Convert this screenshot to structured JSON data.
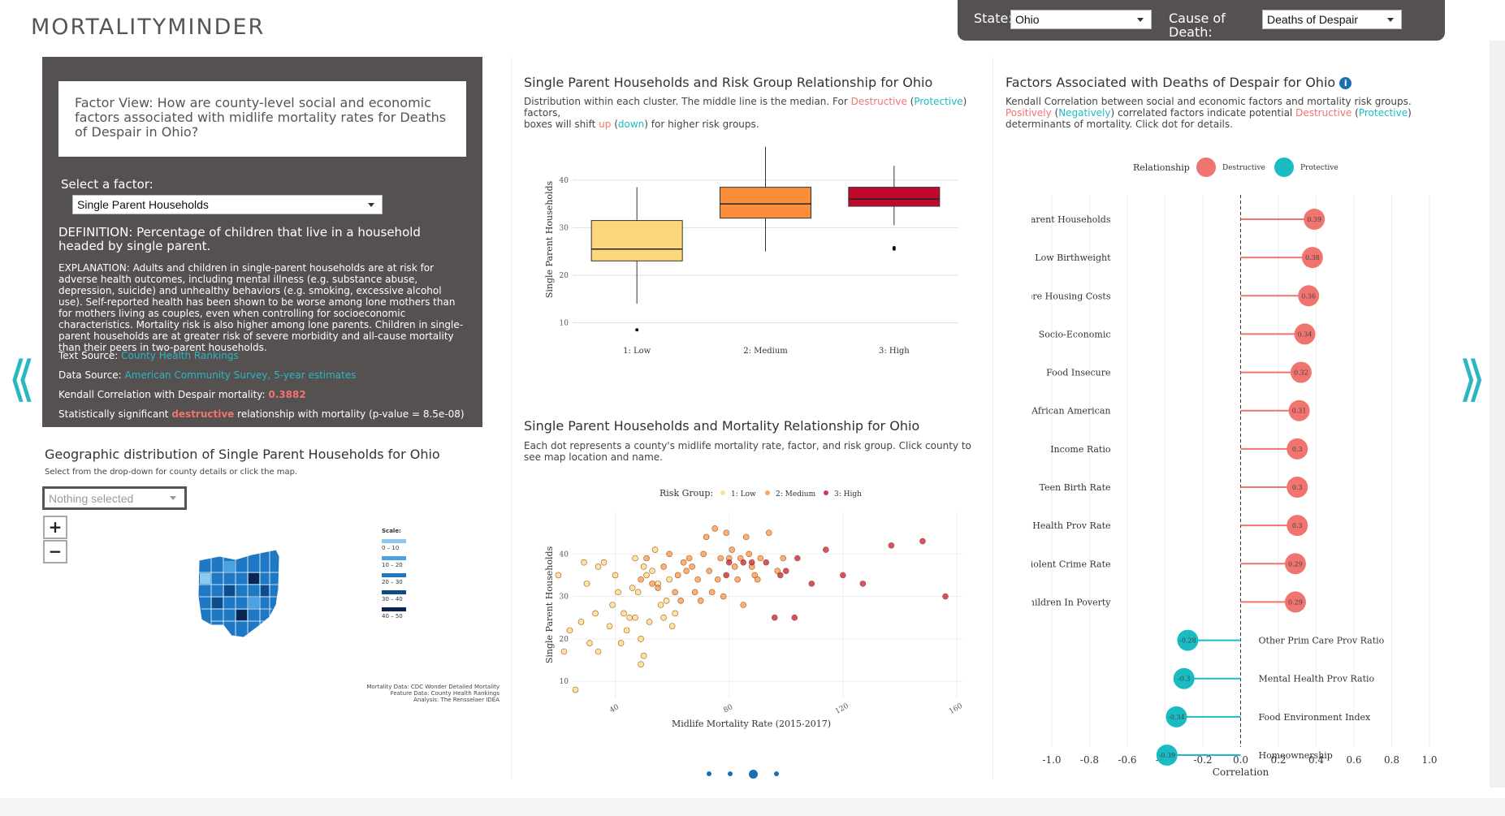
{
  "app": {
    "title": "MORTALITYMINDER"
  },
  "topbar": {
    "state_label": "State:",
    "state_value": "Ohio",
    "cause_label": "Cause of Death:",
    "cause_value": "Deaths of Despair"
  },
  "factor_panel": {
    "question": "Factor View: How are county-level social and economic factors associated with midlife mortality rates for Deaths of Despair in Ohio?",
    "select_label": "Select a factor:",
    "select_value": "Single Parent Households",
    "definition": "DEFINITION: Percentage of children that live in a household headed by single parent.",
    "explanation": "EXPLANATION: Adults and children in single-parent households are at risk for adverse health outcomes, including mental illness (e.g. substance abuse, depression, suicide) and unhealthy behaviors (e.g. smoking, excessive alcohol use). Self-reported health has been shown to be worse among lone mothers than for mothers living as couples, even when controlling for socioeconomic characteristics. Mortality risk is also higher among lone parents. Children in single-parent households are at greater risk of severe morbidity and all-cause mortality than their peers in two-parent households.",
    "text_source_label": "Text Source: ",
    "text_source_link": "County Health Rankings",
    "data_source_label": "Data Source: ",
    "data_source_link": "American Community Survey, 5-year estimates",
    "kendall_label": "Kendall Correlation with Despair mortality: ",
    "kendall_value": "0.3882",
    "sig_prefix": "Statistically significant ",
    "sig_word": "destructive",
    "sig_suffix": " relationship with mortality (p-value = 8.5e-08)"
  },
  "geo": {
    "title": "Geographic distribution of Single Parent Households for Ohio",
    "subtitle": "Select from the drop-down for county details or click the map.",
    "dropdown_placeholder": "Nothing selected",
    "zoom_in": "+",
    "zoom_out": "−",
    "scale_title": "Scale:",
    "scale": [
      {
        "label": "0 – 10",
        "color": "#8cc8f0"
      },
      {
        "label": "10 – 20",
        "color": "#4aa3e0"
      },
      {
        "label": "20 – 30",
        "color": "#1e78c4"
      },
      {
        "label": "30 – 40",
        "color": "#0f4c8a"
      },
      {
        "label": "40 – 50",
        "color": "#0a2550"
      }
    ],
    "credit_1": "Mortality Data: CDC Wonder Detailed Mortality",
    "credit_2": "Feature Data: County Health Rankings",
    "credit_3": "Analysis: The Rensselaer IDEA"
  },
  "boxplot": {
    "title": "Single Parent Households and Risk Group Relationship for Ohio",
    "desc_1": "Distribution within each cluster. The middle line is the median. For ",
    "desc_destructive": "Destructive",
    "desc_2": " (",
    "desc_protective": "Protective",
    "desc_3": ") factors,",
    "desc_4": "boxes will shift ",
    "desc_up": "up",
    "desc_5": " (",
    "desc_down": "down",
    "desc_6": ") for higher risk groups."
  },
  "scatter": {
    "title": "Single Parent Households and Mortality Relationship for Ohio",
    "desc": "Each dot represents a county's midlife mortality rate, factor, and risk group. Click county to see map location and name."
  },
  "correlation": {
    "title": "Factors Associated with Deaths of Despair for Ohio",
    "desc_1": "Kendall Correlation between social and economic factors and mortality risk groups. ",
    "desc_pos": "Positively",
    "desc_2": " (",
    "desc_neg": "Negatively",
    "desc_3": ") correlated factors indicate potential ",
    "desc_destructive": "Destructive",
    "desc_4": " (",
    "desc_protective": "Protective",
    "desc_5": ") determinants of mortality. Click dot for details."
  },
  "colors": {
    "destructive": "#f07470",
    "protective": "#1abcc4",
    "low": "#fdd87a",
    "medium": "#fb8e3a",
    "high": "#c0092b",
    "accent": "#2ab7c2"
  },
  "chart_data": [
    {
      "type": "boxplot",
      "categories": [
        "1: Low",
        "2: Medium",
        "3: High"
      ],
      "boxes": [
        {
          "name": "1: Low",
          "whisker_low": 14,
          "q1": 23,
          "median": 25.5,
          "q3": 31.5,
          "whisker_high": 38.5,
          "outliers": [
            8.5
          ]
        },
        {
          "name": "2: Medium",
          "whisker_low": 25,
          "q1": 32,
          "median": 35,
          "q3": 38.5,
          "whisker_high": 47,
          "outliers": []
        },
        {
          "name": "3: High",
          "whisker_low": 30.5,
          "q1": 34.5,
          "median": 36,
          "q3": 38.5,
          "whisker_high": 43,
          "outliers": [
            25.5,
            25.8
          ]
        }
      ],
      "ylabel": "Single Parent Households",
      "yticks": [
        10,
        20,
        30,
        40
      ],
      "ylim": [
        7,
        48
      ],
      "legend": "none",
      "grid": true
    },
    {
      "type": "scatter",
      "xlabel": "Midlife Mortality Rate (2015-2017)",
      "ylabel": "Single Parent Households",
      "xticks": [
        40,
        80,
        120,
        160
      ],
      "yticks": [
        10,
        20,
        30,
        40
      ],
      "xlim": [
        25,
        162
      ],
      "ylim": [
        6,
        50
      ],
      "legend_title": "Risk Group:",
      "series": [
        {
          "name": "1: Low",
          "points": [
            [
              20,
              35
            ],
            [
              22,
              17
            ],
            [
              24,
              22
            ],
            [
              26,
              8
            ],
            [
              28,
              24
            ],
            [
              29,
              38
            ],
            [
              30,
              33
            ],
            [
              31,
              19
            ],
            [
              33,
              26
            ],
            [
              34,
              37
            ],
            [
              34,
              17
            ],
            [
              36,
              38
            ],
            [
              38,
              23
            ],
            [
              39,
              28
            ],
            [
              40,
              35
            ],
            [
              41,
              31
            ],
            [
              42,
              19
            ],
            [
              43,
              26
            ],
            [
              44,
              22
            ],
            [
              45,
              25
            ],
            [
              46,
              32
            ],
            [
              47,
              39
            ],
            [
              47,
              25
            ],
            [
              48,
              31
            ],
            [
              49,
              14
            ],
            [
              49,
              20
            ],
            [
              50,
              16
            ],
            [
              50,
              37
            ],
            [
              51,
              35
            ],
            [
              52,
              24
            ],
            [
              53,
              36
            ],
            [
              54,
              41
            ],
            [
              55,
              33
            ],
            [
              56,
              28
            ],
            [
              57,
              25
            ],
            [
              58,
              29
            ],
            [
              59,
              34
            ],
            [
              60,
              23
            ],
            [
              61,
              26
            ]
          ]
        },
        {
          "name": "2: Medium",
          "points": [
            [
              49,
              34
            ],
            [
              51,
              39
            ],
            [
              53,
              33
            ],
            [
              55,
              32
            ],
            [
              57,
              37
            ],
            [
              59,
              40
            ],
            [
              61,
              31
            ],
            [
              62,
              35
            ],
            [
              63,
              29
            ],
            [
              64,
              38
            ],
            [
              65,
              36
            ],
            [
              66,
              39
            ],
            [
              67,
              37
            ],
            [
              68,
              31
            ],
            [
              69,
              34
            ],
            [
              70,
              29
            ],
            [
              71,
              40
            ],
            [
              72,
              44
            ],
            [
              73,
              36
            ],
            [
              74,
              31
            ],
            [
              75,
              46
            ],
            [
              76,
              34
            ],
            [
              77,
              39
            ],
            [
              78,
              30
            ],
            [
              79,
              45
            ],
            [
              80,
              39
            ],
            [
              81,
              41
            ],
            [
              82,
              37
            ],
            [
              83,
              34
            ],
            [
              84,
              39
            ],
            [
              85,
              28
            ],
            [
              86,
              44
            ],
            [
              87,
              40
            ],
            [
              88,
              37
            ],
            [
              89,
              35
            ],
            [
              90,
              34
            ],
            [
              91,
              39
            ],
            [
              94,
              45
            ],
            [
              97,
              36
            ],
            [
              99,
              39
            ]
          ]
        },
        {
          "name": "3: High",
          "points": [
            [
              79,
              35
            ],
            [
              80,
              38
            ],
            [
              85,
              38
            ],
            [
              88,
              38
            ],
            [
              93,
              38
            ],
            [
              96,
              25
            ],
            [
              98,
              35
            ],
            [
              100,
              36
            ],
            [
              103,
              25
            ],
            [
              104,
              39
            ],
            [
              109,
              33
            ],
            [
              114,
              41
            ],
            [
              120,
              35
            ],
            [
              127,
              33
            ],
            [
              137,
              42
            ],
            [
              148,
              43
            ],
            [
              156,
              30
            ]
          ]
        }
      ],
      "grid": true
    },
    {
      "type": "lollipop",
      "xlabel": "Correlation",
      "xticks": [
        -1.0,
        -0.8,
        -0.6,
        -0.4,
        -0.2,
        0.0,
        0.2,
        0.4,
        0.6,
        0.8,
        1.0
      ],
      "xlim": [
        -1.0,
        1.0
      ],
      "legend_title": "Relationship",
      "legend": [
        {
          "name": "Destructive",
          "color": "#f07470"
        },
        {
          "name": "Protective",
          "color": "#1abcc4"
        }
      ],
      "items": [
        {
          "label": "Single Parent Households",
          "value": 0.39,
          "type": "Destructive"
        },
        {
          "label": "Low Birthweight",
          "value": 0.38,
          "type": "Destructive"
        },
        {
          "label": "Severe Housing Costs",
          "value": 0.36,
          "type": "Destructive"
        },
        {
          "label": "Socio-Economic",
          "value": 0.34,
          "type": "Destructive"
        },
        {
          "label": "Food Insecure",
          "value": 0.32,
          "type": "Destructive"
        },
        {
          "label": "African American",
          "value": 0.31,
          "type": "Destructive"
        },
        {
          "label": "Income Ratio",
          "value": 0.3,
          "type": "Destructive"
        },
        {
          "label": "Teen Birth Rate",
          "value": 0.3,
          "type": "Destructive"
        },
        {
          "label": "Mental Health Prov Rate",
          "value": 0.3,
          "type": "Destructive"
        },
        {
          "label": "Violent Crime Rate",
          "value": 0.29,
          "type": "Destructive"
        },
        {
          "label": "Children In Poverty",
          "value": 0.29,
          "type": "Destructive"
        },
        {
          "label": "Other Prim Care Prov Ratio",
          "value": -0.28,
          "type": "Protective"
        },
        {
          "label": "Mental Health Prov Ratio",
          "value": -0.3,
          "type": "Protective"
        },
        {
          "label": "Food Environment Index",
          "value": -0.34,
          "type": "Protective"
        },
        {
          "label": "Homeownership",
          "value": -0.39,
          "type": "Protective"
        }
      ],
      "grid": true
    }
  ],
  "pager": {
    "count": 4,
    "active": 3
  }
}
